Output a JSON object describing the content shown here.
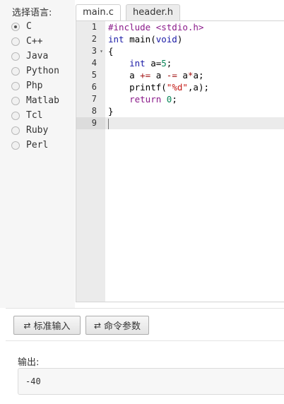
{
  "language_panel": {
    "title": "选择语言:",
    "options": [
      {
        "label": "C",
        "selected": true
      },
      {
        "label": "C++",
        "selected": false
      },
      {
        "label": "Java",
        "selected": false
      },
      {
        "label": "Python",
        "selected": false
      },
      {
        "label": "Php",
        "selected": false
      },
      {
        "label": "Matlab",
        "selected": false
      },
      {
        "label": "Tcl",
        "selected": false
      },
      {
        "label": "Ruby",
        "selected": false
      },
      {
        "label": "Perl",
        "selected": false
      }
    ]
  },
  "tabs": [
    {
      "label": "main.c",
      "active": true
    },
    {
      "label": "header.h",
      "active": false
    }
  ],
  "editor": {
    "line_numbers": [
      "1",
      "2",
      "3",
      "4",
      "5",
      "6",
      "7",
      "8",
      "9"
    ],
    "fold_marker": "▾",
    "code_lines": [
      "#include <stdio.h>",
      "int main(void)",
      "{",
      "    int a=5;",
      "    a += a -= a*a;",
      "    printf(\"%d\",a);",
      "    return 0;",
      "}",
      ""
    ]
  },
  "toolbar": {
    "stdin_button": "标准输入",
    "args_button": "命令参数",
    "button_icon": "swap-arrows-icon"
  },
  "output": {
    "label": "输出:",
    "value": "-40"
  },
  "colors": {
    "keyword": "#8a1a8a",
    "type": "#1a1aa6",
    "string": "#c41a16",
    "number": "#098658"
  }
}
